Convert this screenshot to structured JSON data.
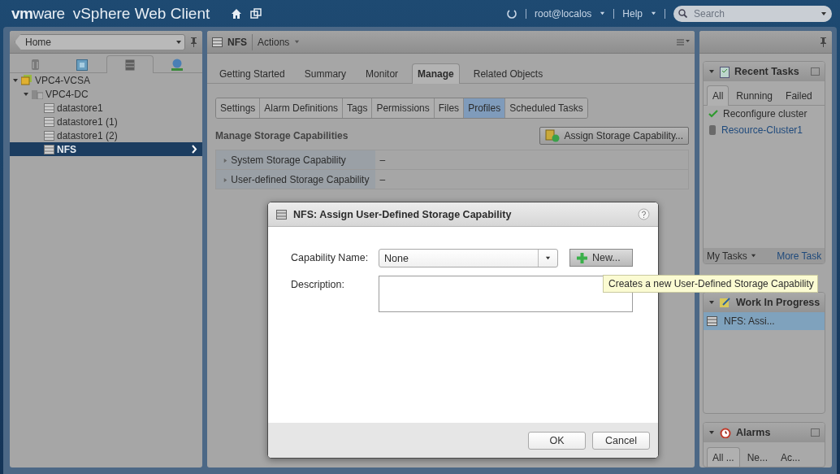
{
  "header": {
    "logo": "**vm**ware",
    "product": "vSphere Web Client",
    "user": "root@localos",
    "help": "Help",
    "search": {
      "placeholder": "Search"
    }
  },
  "navigator": {
    "location": "Home",
    "icon_tabs": [
      {
        "kind": "hosts",
        "selected": false
      },
      {
        "kind": "vms",
        "selected": false
      },
      {
        "kind": "storage",
        "selected": true
      },
      {
        "kind": "network",
        "selected": false
      }
    ],
    "tree": [
      {
        "label": "VPC4-VCSA",
        "kind": "vcenter",
        "expanded": true,
        "selected": false,
        "children": [
          {
            "label": "VPC4-DC",
            "kind": "datacenter",
            "expanded": true,
            "selected": false,
            "children": [
              {
                "label": "datastore1",
                "kind": "datastore",
                "selected": false
              },
              {
                "label": "datastore1 (1)",
                "kind": "datastore",
                "selected": false
              },
              {
                "label": "datastore1 (2)",
                "kind": "datastore",
                "selected": false
              },
              {
                "label": "NFS",
                "kind": "datastore",
                "selected": true
              }
            ]
          }
        ]
      }
    ]
  },
  "object": {
    "title": "NFS",
    "actions": "Actions",
    "tabs": [
      {
        "label": "Getting Started",
        "selected": false
      },
      {
        "label": "Summary",
        "selected": false
      },
      {
        "label": "Monitor",
        "selected": false
      },
      {
        "label": "Manage",
        "selected": true
      },
      {
        "label": "Related Objects",
        "selected": false
      }
    ],
    "subtabs": [
      {
        "label": "Settings",
        "selected": false
      },
      {
        "label": "Alarm Definitions",
        "selected": false
      },
      {
        "label": "Tags",
        "selected": false
      },
      {
        "label": "Permissions",
        "selected": false
      },
      {
        "label": "Files",
        "selected": false
      },
      {
        "label": "Profiles",
        "selected": true
      },
      {
        "label": "Scheduled Tasks",
        "selected": false
      }
    ],
    "section_title": "Manage Storage Capabilities",
    "assign_button": "Assign Storage Capability...",
    "rows": [
      {
        "label": "System Storage Capability",
        "value": "–"
      },
      {
        "label": "User-defined Storage Capability",
        "value": "–"
      }
    ]
  },
  "dialog": {
    "title": "NFS: Assign User-Defined Storage Capability",
    "capability_label": "Capability Name:",
    "capability_value": "None",
    "new_button": "New...",
    "description_label": "Description:",
    "buttons": [
      {
        "label": "OK"
      },
      {
        "label": "Cancel"
      }
    ]
  },
  "tooltip": "Creates a new User-Defined Storage Capability",
  "recent_tasks": {
    "title": "Recent Tasks",
    "tabs": [
      {
        "label": "All",
        "selected": true
      },
      {
        "label": "Running",
        "selected": false
      },
      {
        "label": "Failed",
        "selected": false
      }
    ],
    "items": [
      {
        "label": "Reconfigure cluster",
        "kind": "status"
      },
      {
        "label": "Resource-Cluster1",
        "kind": "link"
      }
    ],
    "my_tasks": "My Tasks",
    "more_tasks": "More Task"
  },
  "work_in_progress": {
    "title": "Work In Progress",
    "items": [
      {
        "label": "NFS: Assi...",
        "selected": true
      }
    ]
  },
  "alarms": {
    "title": "Alarms",
    "tabs": [
      {
        "label": "All ...",
        "selected": true
      },
      {
        "label": "Ne...",
        "selected": false
      },
      {
        "label": "Ac...",
        "selected": false
      }
    ]
  }
}
